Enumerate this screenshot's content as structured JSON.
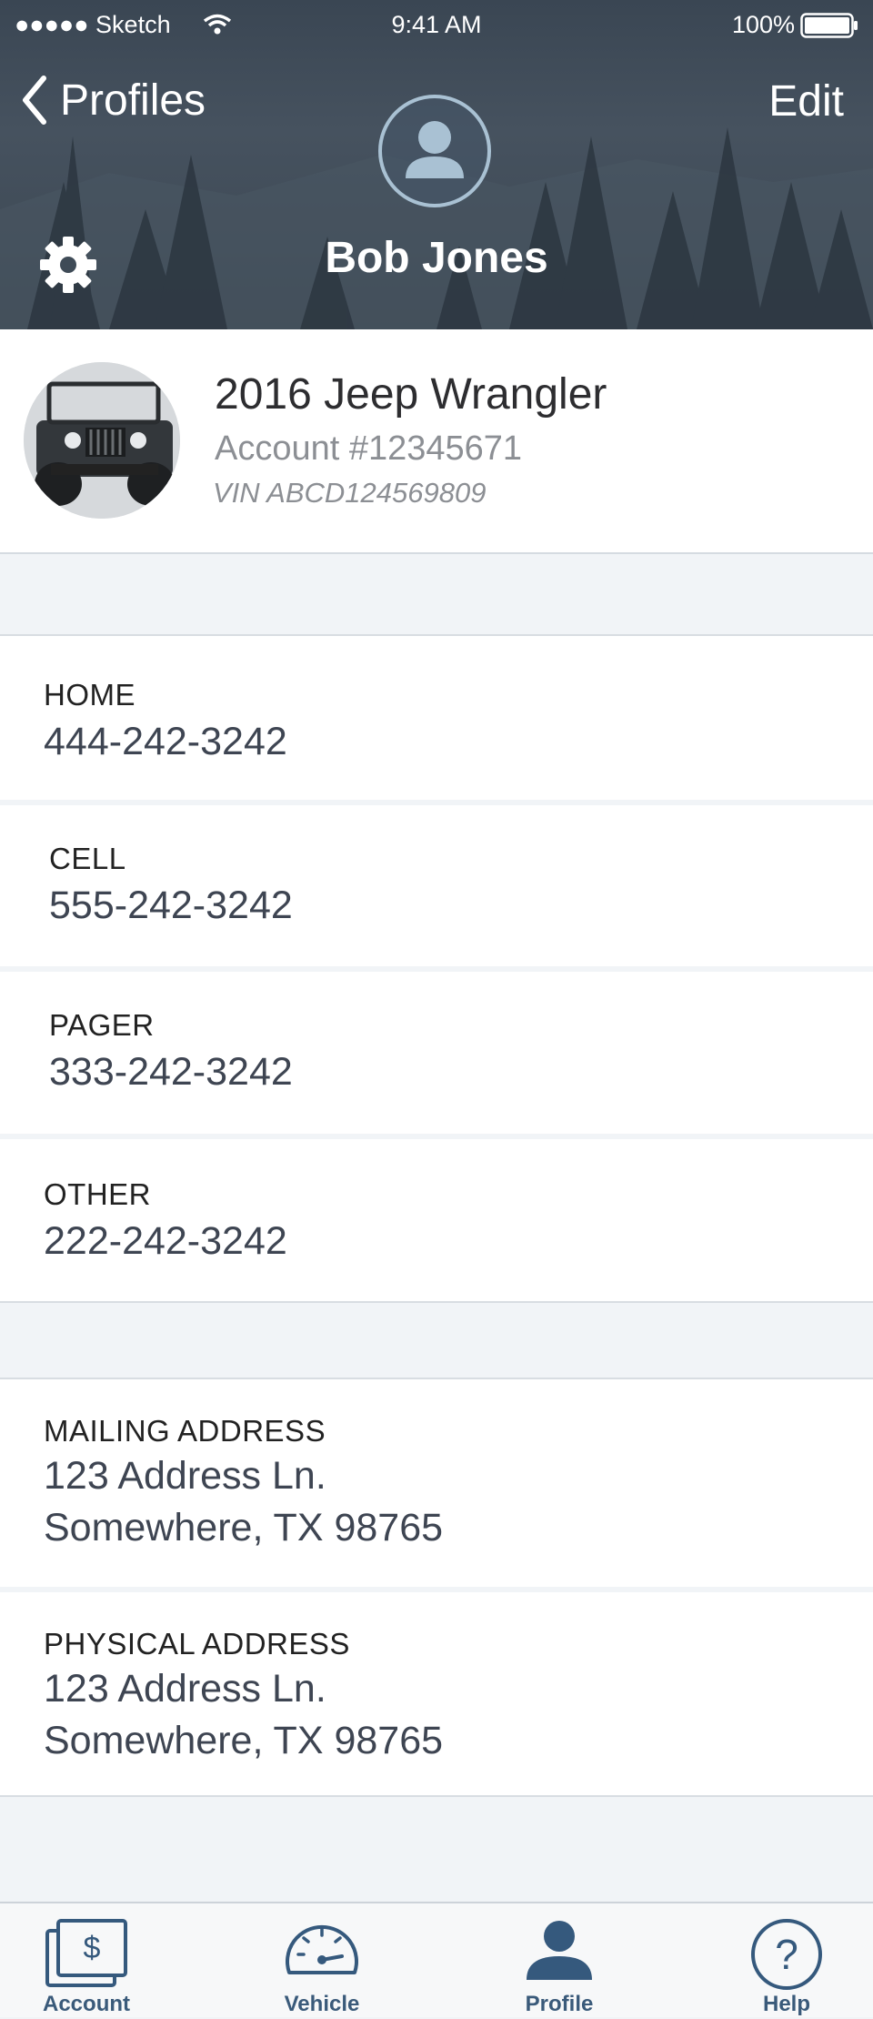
{
  "status_bar": {
    "carrier": "●●●●● Sketch",
    "time": "9:41 AM",
    "battery": "100%"
  },
  "header": {
    "back_label": "Profiles",
    "edit_label": "Edit",
    "name": "Bob Jones"
  },
  "vehicle": {
    "title": "2016 Jeep Wrangler",
    "account": "Account #12345671",
    "vin": "VIN ABCD124569809"
  },
  "contacts": [
    {
      "label": "HOME",
      "value": "444-242-3242"
    },
    {
      "label": "CELL",
      "value": "555-242-3242"
    },
    {
      "label": "PAGER",
      "value": "333-242-3242"
    },
    {
      "label": "OTHER",
      "value": "222-242-3242"
    }
  ],
  "addresses": [
    {
      "label": "MAILING ADDRESS",
      "line1": "123 Address Ln.",
      "line2": "Somewhere, TX 98765"
    },
    {
      "label": "PHYSICAL ADDRESS",
      "line1": "123 Address Ln.",
      "line2": "Somewhere, TX 98765"
    }
  ],
  "tabs": [
    {
      "label": "Account",
      "icon": "account-icon",
      "active": false
    },
    {
      "label": "Vehicle",
      "icon": "speedometer-icon",
      "active": false
    },
    {
      "label": "Profile",
      "icon": "person-icon",
      "active": true
    },
    {
      "label": "Help",
      "icon": "question-icon",
      "active": false
    }
  ],
  "colors": {
    "accent": "#35597d",
    "header_bg": "#3f4b57",
    "page_bg": "#f1f4f7",
    "avatar_ring": "#a9c1d3"
  }
}
